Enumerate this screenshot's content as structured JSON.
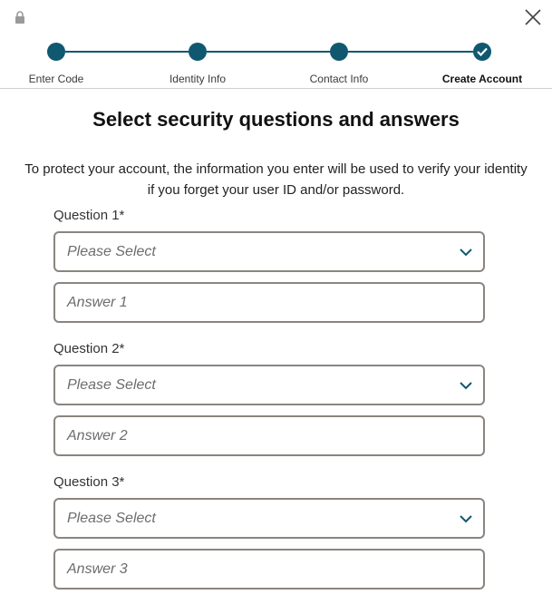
{
  "header": {
    "lock_icon": "lock-icon",
    "close_icon": "close-icon"
  },
  "stepper": {
    "accent": "#0f5870",
    "steps": [
      {
        "label": "Enter Code",
        "state": "complete"
      },
      {
        "label": "Identity Info",
        "state": "complete"
      },
      {
        "label": "Contact Info",
        "state": "complete"
      },
      {
        "label": "Create Account",
        "state": "current"
      }
    ]
  },
  "main": {
    "title": "Select security questions and answers",
    "description": "To protect your account, the information you enter will be used to verify your identity if you forget your user ID and/or password.",
    "questions": [
      {
        "label": "Question 1*",
        "select_value": "Please Select",
        "answer_placeholder": "Answer 1"
      },
      {
        "label": "Question 2*",
        "select_value": "Please Select",
        "answer_placeholder": "Answer 2"
      },
      {
        "label": "Question 3*",
        "select_value": "Please Select",
        "answer_placeholder": "Answer 3"
      }
    ]
  }
}
